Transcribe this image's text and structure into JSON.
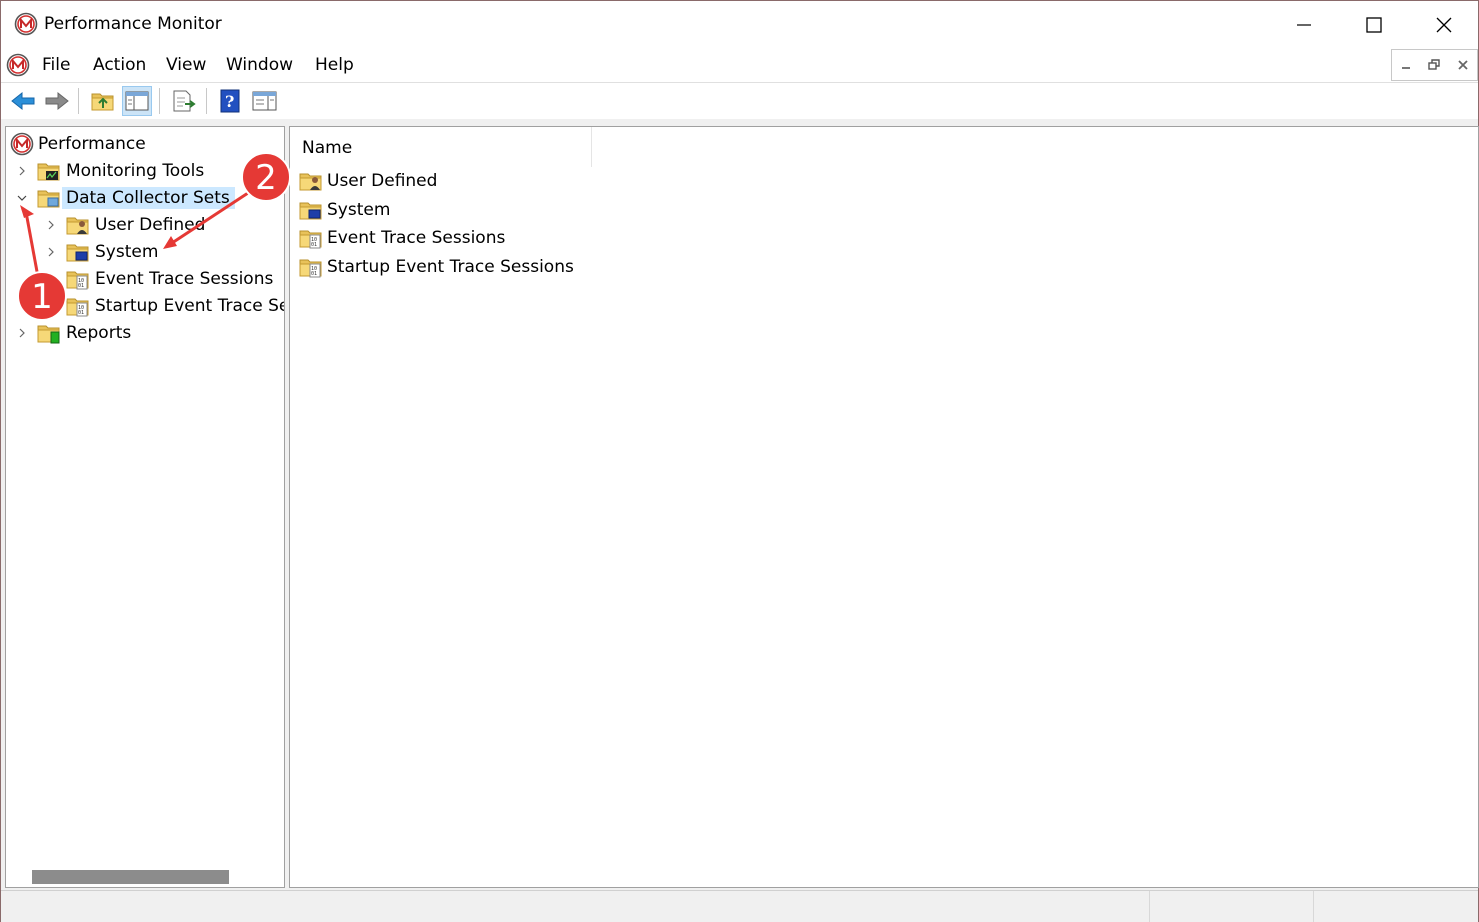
{
  "window": {
    "title": "Performance Monitor"
  },
  "menubar": {
    "items": [
      "File",
      "Action",
      "View",
      "Window",
      "Help"
    ]
  },
  "toolbar": {
    "buttons": [
      "back-arrow-icon",
      "forward-arrow-icon",
      "up-folder-icon",
      "show-hide-tree-icon",
      "export-list-icon",
      "help-icon",
      "properties-pane-icon"
    ]
  },
  "tree": {
    "root": "Performance",
    "items": [
      {
        "label": "Monitoring Tools"
      },
      {
        "label": "Data Collector Sets"
      },
      {
        "label": "User Defined"
      },
      {
        "label": "System"
      },
      {
        "label": "Event Trace Sessions"
      },
      {
        "label": "Startup Event Trace Sessions"
      },
      {
        "label": "Reports"
      }
    ]
  },
  "list": {
    "column": "Name",
    "rows": [
      {
        "label": "User Defined"
      },
      {
        "label": "System"
      },
      {
        "label": "Event Trace Sessions"
      },
      {
        "label": "Startup Event Trace Sessions"
      }
    ]
  },
  "annotations": {
    "badge1": "1",
    "badge2": "2",
    "color": "#e53935"
  }
}
